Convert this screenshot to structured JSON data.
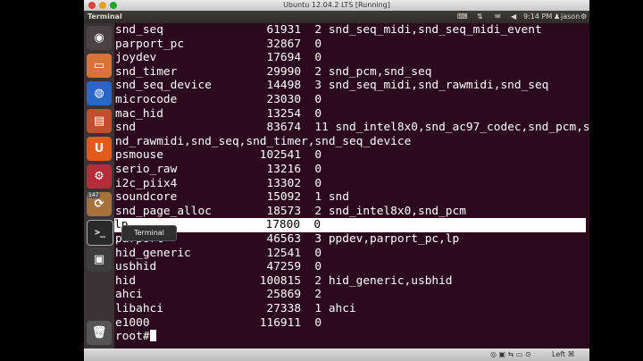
{
  "vm": {
    "title": "Ubuntu 12.04.2 LTS [Running]"
  },
  "panel": {
    "app_title": "Terminal",
    "time": "9:14 PM",
    "user": "jason"
  },
  "launcher": {
    "badge": "147",
    "tooltip": "Terminal"
  },
  "terminal": {
    "lines": [
      "snd_seq               61931  2 snd_seq_midi,snd_seq_midi_event",
      "parport_pc            32867  0",
      "joydev                17694  0",
      "snd_timer             29990  2 snd_pcm,snd_seq",
      "snd_seq_device        14498  3 snd_seq_midi,snd_rawmidi,snd_seq",
      "microcode             23030  0",
      "mac_hid               13254  0",
      "snd                   83674  11 snd_intel8x0,snd_ac97_codec,snd_pcm,s",
      "nd_rawmidi,snd_seq,snd_timer,snd_seq_device",
      "psmouse              102541  0",
      "serio_raw             13216  0",
      "i2c_piix4             13302  0",
      "soundcore             15092  1 snd",
      "snd_page_alloc        18573  2 snd_intel8x0,snd_pcm",
      "lp                    17800  0",
      "parport               46563  3 ppdev,parport_pc,lp",
      "hid_generic           12541  0",
      "usbhid                47259  0",
      "hid                  100815  2 hid_generic,usbhid",
      "ahci                  25869  2",
      "libahci               27338  1 ahci",
      "e1000                116911  0"
    ],
    "prompt": "root#"
  },
  "statusbar": {
    "host_key": "Left ⌘"
  }
}
